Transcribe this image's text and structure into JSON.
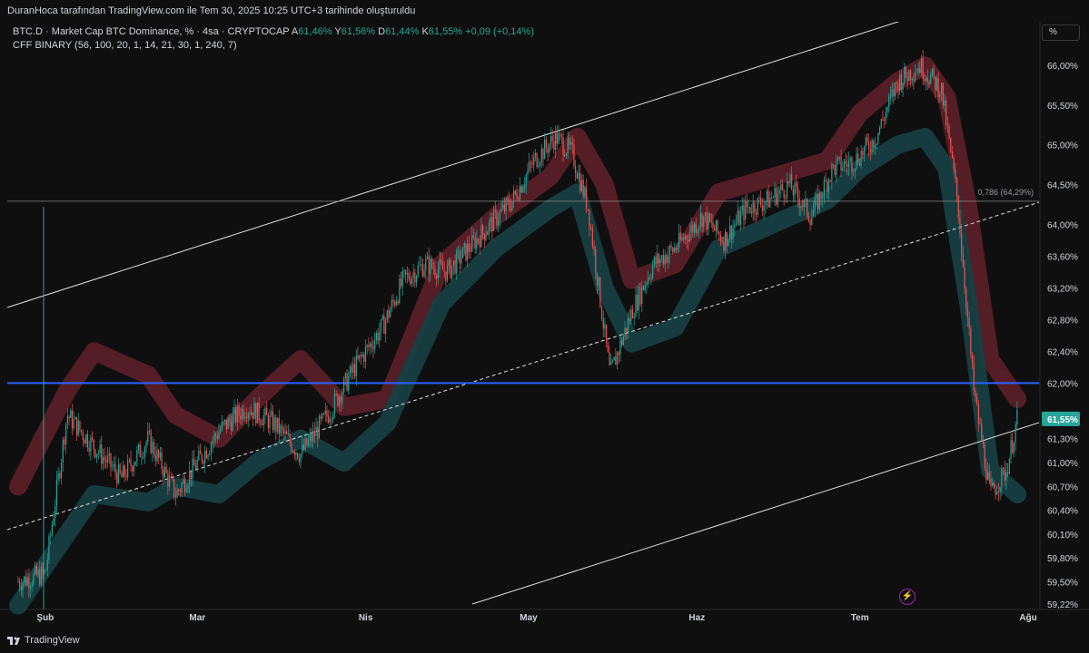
{
  "header": {
    "credit": "DuranHoca tarafından TradingView.com ile Tem 30, 2025 10:25 UTC+3 tarihinde oluşturuldu"
  },
  "legend": {
    "symbol": "BTC.D · Market Cap BTC Dominance, % · 4sa · CRYPTOCAP",
    "open_label": "A",
    "open": "61,46%",
    "high_label": "Y",
    "high": "61,56%",
    "low_label": "D",
    "low": "61,44%",
    "close_label": "K",
    "close": "61,55%",
    "change": "+0,09 (+0,14%)",
    "indicator": "CFF BINARY (56, 100, 20, 1, 14, 21, 30, 1, 240, 7)"
  },
  "scale_button": "%",
  "footer": {
    "brand": "TradingView"
  },
  "colors": {
    "background": "#0f0f0f",
    "up": "#26a69a",
    "down": "#ef5350",
    "band_upper": "#5a1f27",
    "band_lower": "#173f42",
    "support_line": "#2962ff",
    "channel": "#e0e0e0",
    "price_label": "#26a69a"
  },
  "icons": {
    "alert": "lightning-icon"
  },
  "chart_data": {
    "type": "line",
    "title": "BTC.D · Market Cap BTC Dominance, % · 4sa · CRYPTOCAP",
    "y_axis": {
      "unit": "%",
      "ticks": [
        "66,00%",
        "65,50%",
        "65,00%",
        "64,50%",
        "64,00%",
        "63,60%",
        "63,20%",
        "62,80%",
        "62,40%",
        "62,00%",
        "61,30%",
        "61,00%",
        "60,70%",
        "60,40%",
        "60,10%",
        "59,80%",
        "59,50%",
        "59,22%"
      ],
      "ylim": [
        59.15,
        66.55
      ]
    },
    "x_axis": {
      "ticks": [
        "Şub",
        "Mar",
        "Nis",
        "May",
        "Haz",
        "Tem",
        "Ağu"
      ]
    },
    "current_price": {
      "label": "61,55%",
      "value": 61.55
    },
    "fib_level": {
      "label": "0,786 (64,29%)",
      "value": 64.29
    },
    "horizontal_line": {
      "value": 62.0
    },
    "series": [
      {
        "name": "BTC.D",
        "x": [
          "2025-01-27",
          "2025-02-01",
          "2025-02-05",
          "2025-02-10",
          "2025-02-15",
          "2025-02-20",
          "2025-02-25",
          "2025-03-01",
          "2025-03-05",
          "2025-03-10",
          "2025-03-15",
          "2025-03-20",
          "2025-03-25",
          "2025-03-30",
          "2025-04-04",
          "2025-04-08",
          "2025-04-12",
          "2025-04-16",
          "2025-04-20",
          "2025-04-24",
          "2025-04-28",
          "2025-05-02",
          "2025-05-06",
          "2025-05-09",
          "2025-05-12",
          "2025-05-16",
          "2025-05-20",
          "2025-05-24",
          "2025-05-28",
          "2025-06-02",
          "2025-06-06",
          "2025-06-10",
          "2025-06-14",
          "2025-06-18",
          "2025-06-22",
          "2025-06-26",
          "2025-06-30",
          "2025-07-04",
          "2025-07-08",
          "2025-07-12",
          "2025-07-16",
          "2025-07-19",
          "2025-07-22",
          "2025-07-25",
          "2025-07-28",
          "2025-07-30"
        ],
        "values": [
          59.5,
          59.6,
          61.6,
          61.2,
          60.8,
          61.3,
          60.6,
          61.0,
          61.4,
          61.7,
          61.5,
          61.1,
          61.6,
          62.2,
          62.7,
          63.3,
          63.5,
          63.4,
          63.7,
          64.0,
          64.3,
          64.8,
          65.1,
          64.9,
          64.2,
          62.1,
          62.9,
          63.5,
          63.7,
          64.1,
          63.8,
          64.2,
          64.3,
          64.5,
          64.1,
          64.7,
          64.8,
          65.1,
          65.8,
          66.0,
          65.7,
          64.3,
          61.9,
          60.6,
          60.9,
          61.55
        ]
      },
      {
        "name": "upper",
        "x": [
          "2025-01-27",
          "2025-02-05",
          "2025-02-10",
          "2025-02-20",
          "2025-02-25",
          "2025-03-05",
          "2025-03-12",
          "2025-03-20",
          "2025-03-28",
          "2025-04-05",
          "2025-04-15",
          "2025-04-25",
          "2025-05-05",
          "2025-05-10",
          "2025-05-15",
          "2025-05-20",
          "2025-05-28",
          "2025-06-05",
          "2025-06-15",
          "2025-06-25",
          "2025-07-01",
          "2025-07-08",
          "2025-07-13",
          "2025-07-17",
          "2025-07-21",
          "2025-07-25",
          "2025-07-30"
        ],
        "values": [
          60.7,
          61.9,
          62.4,
          62.1,
          61.6,
          61.3,
          61.8,
          62.3,
          61.7,
          61.8,
          63.5,
          64.1,
          64.6,
          65.1,
          64.5,
          63.3,
          63.5,
          64.4,
          64.6,
          64.8,
          65.4,
          65.8,
          66.0,
          65.6,
          64.2,
          62.3,
          61.8
        ]
      },
      {
        "name": "lower",
        "x": [
          "2025-01-27",
          "2025-02-05",
          "2025-02-10",
          "2025-02-20",
          "2025-02-25",
          "2025-03-05",
          "2025-03-12",
          "2025-03-20",
          "2025-03-28",
          "2025-04-05",
          "2025-04-15",
          "2025-04-25",
          "2025-05-05",
          "2025-05-10",
          "2025-05-15",
          "2025-05-20",
          "2025-05-28",
          "2025-06-05",
          "2025-06-15",
          "2025-06-25",
          "2025-07-01",
          "2025-07-08",
          "2025-07-13",
          "2025-07-17",
          "2025-07-21",
          "2025-07-25",
          "2025-07-30"
        ],
        "values": [
          59.2,
          60.1,
          60.6,
          60.5,
          60.7,
          60.6,
          61.0,
          61.3,
          61.0,
          61.5,
          63.0,
          63.7,
          64.2,
          64.4,
          63.2,
          62.5,
          62.7,
          63.7,
          64.0,
          64.3,
          64.7,
          65.0,
          65.1,
          64.7,
          63.0,
          60.9,
          60.6
        ]
      }
    ]
  }
}
